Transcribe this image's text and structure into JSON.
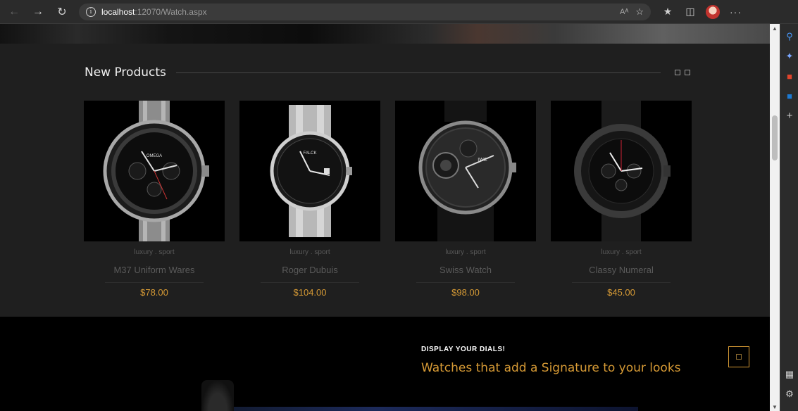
{
  "browser": {
    "url_host": "localhost",
    "url_rest": ":12070/Watch.aspx",
    "read_aloud_label": "Aᴬ"
  },
  "section": {
    "title": "New Products"
  },
  "products": [
    {
      "tags": "luxury . sport",
      "name": "M37 Uniform Wares",
      "price": "$78.00"
    },
    {
      "tags": "luxury . sport",
      "name": "Roger Dubuis",
      "price": "$104.00"
    },
    {
      "tags": "luxury . sport",
      "name": "Swiss Watch",
      "price": "$98.00"
    },
    {
      "tags": "luxury . sport",
      "name": "Classy Numeral",
      "price": "$45.00"
    }
  ],
  "display": {
    "label": "DISPLAY YOUR DIALS!",
    "headline": "Watches that add a Signature to your looks"
  },
  "watch_brands": [
    "OMEGA",
    "FALCK",
    "IWC",
    ""
  ],
  "colors": {
    "accent": "#d69a35",
    "background": "#1f1f1f",
    "footer_band": "#000000"
  },
  "icons": {
    "back": "arrow-left-icon",
    "forward": "arrow-right-icon",
    "refresh": "refresh-icon",
    "info": "info-icon",
    "favorite": "star-plus-icon",
    "favorites": "favorites-icon",
    "collections": "collections-icon",
    "more": "more-icon"
  }
}
